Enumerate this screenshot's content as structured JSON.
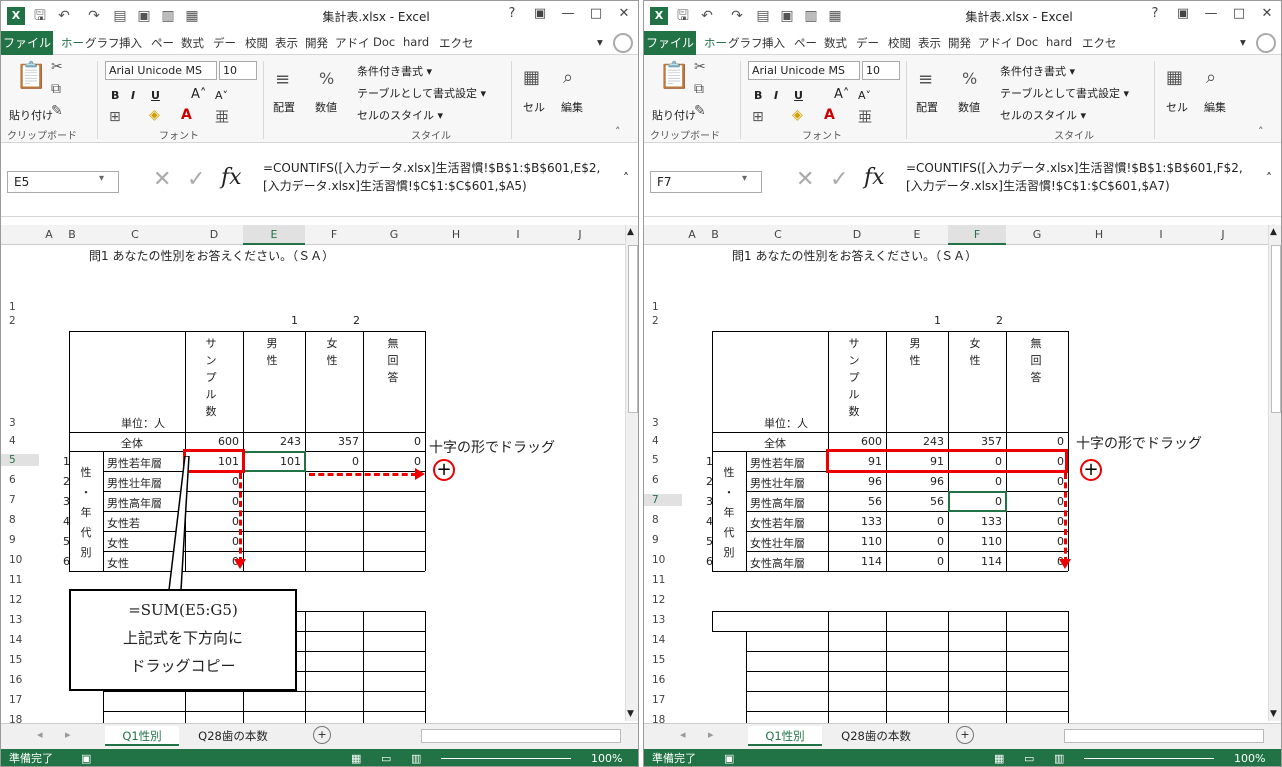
{
  "titlebar": {
    "filename": "集計表.xlsx - Excel",
    "help": "?",
    "minimize": "—",
    "maximize": "□",
    "close": "✕"
  },
  "tabs": [
    "ファイル",
    "ホー",
    "グラフ",
    "挿入",
    "ペー",
    "数式",
    "デー",
    "校閲",
    "表示",
    "開発",
    "アドイ",
    "Doc",
    "hard",
    "エクセ"
  ],
  "ribbon": {
    "paste": "貼り付け",
    "font_name": "Arial Unicode MS",
    "font_size": "10",
    "bold": "B",
    "italic": "I",
    "underline": "U",
    "align": "配置",
    "number": "数値",
    "cond_format": "条件付き書式 ▾",
    "table_format": "テーブルとして書式設定 ▾",
    "cell_style": "セルのスタイル ▾",
    "cells": "セル",
    "edit": "編集",
    "group_clipboard": "クリップボード",
    "group_font": "フォント",
    "group_style": "スタイル"
  },
  "columns": [
    "A",
    "B",
    "C",
    "D",
    "E",
    "F",
    "G",
    "H",
    "I",
    "J"
  ],
  "rows": [
    "1",
    "2",
    "3",
    "4",
    "5",
    "6",
    "7",
    "8",
    "9",
    "10",
    "11",
    "12",
    "13",
    "14",
    "15",
    "16",
    "17",
    "18"
  ],
  "sheet": {
    "question": "問1 あなたの性別をお答えください。（ＳＡ）",
    "code1": "1",
    "code2": "2",
    "hdr_sample": [
      "サ",
      "ン",
      "プ",
      "ル",
      "数"
    ],
    "hdr_male": [
      "男",
      "性"
    ],
    "hdr_female": [
      "女",
      "性"
    ],
    "hdr_noans": [
      "無",
      "回",
      "答"
    ],
    "unit": "単位：人",
    "total_label": "全体",
    "total": {
      "sample": "600",
      "male": "243",
      "female": "357",
      "noans": "0"
    },
    "row_nums": [
      "1",
      "2",
      "3",
      "4",
      "5",
      "6"
    ],
    "side_label": [
      "性",
      "・",
      "年",
      "代",
      "別"
    ],
    "categories": [
      "男性若年層",
      "男性壮年層",
      "男性高年層",
      "女性若年層",
      "女性壮年層",
      "女性高年層"
    ],
    "categories_left_visible": [
      "男性若年層",
      "男性壮年層",
      "男性高年層",
      "女性若",
      "女性",
      "女性"
    ]
  },
  "left": {
    "namebox": "E5",
    "formula": "=COUNTIFS([入力データ.xlsx]生活習慣!$B$1:$B$601,E$2,\n[入力データ.xlsx]生活習慣!$C$1:$C$601,$A5)",
    "selected_col": "E",
    "selected_row": "5",
    "values": [
      [
        "101",
        "101",
        "0",
        "0"
      ],
      [
        "0",
        "",
        "",
        ""
      ],
      [
        "0",
        "",
        "",
        ""
      ],
      [
        "0",
        "",
        "",
        ""
      ],
      [
        "0",
        "",
        "",
        ""
      ],
      [
        "0",
        "",
        "",
        ""
      ]
    ],
    "callout": [
      "=SUM(E5:G5)",
      "上記式を下方向に",
      "ドラッグコピー"
    ],
    "drag_note": "十字の形でドラッグ"
  },
  "right": {
    "namebox": "F7",
    "formula": "=COUNTIFS([入力データ.xlsx]生活習慣!$B$1:$B$601,F$2,\n[入力データ.xlsx]生活習慣!$C$1:$C$601,$A7)",
    "selected_col": "F",
    "selected_row": "7",
    "values": [
      [
        "91",
        "91",
        "0",
        "0"
      ],
      [
        "96",
        "96",
        "0",
        "0"
      ],
      [
        "56",
        "56",
        "0",
        "0"
      ],
      [
        "133",
        "0",
        "133",
        "0"
      ],
      [
        "110",
        "0",
        "110",
        "0"
      ],
      [
        "114",
        "0",
        "114",
        "0"
      ]
    ],
    "drag_note": "十字の形でドラッグ"
  },
  "sheettabs": [
    "Q1性別",
    "Q28歯の本数"
  ],
  "status": {
    "ready": "準備完了",
    "zoom": "100%"
  }
}
